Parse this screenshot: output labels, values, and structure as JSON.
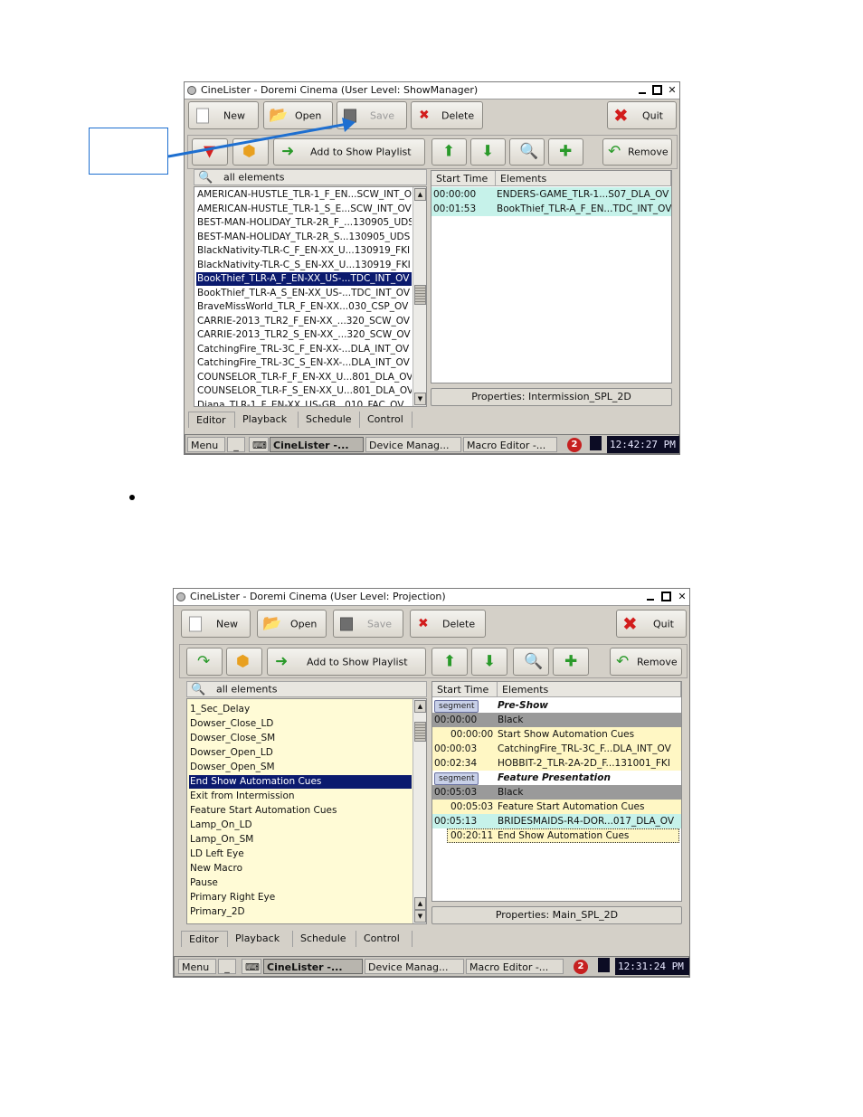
{
  "window1": {
    "title": "CineLister - Doremi Cinema (User Level: ShowManager)",
    "toolbar": {
      "new": "New",
      "open": "Open",
      "save": "Save",
      "delete": "Delete",
      "quit": "Quit",
      "add_to_playlist": "Add to Show Playlist",
      "remove": "Remove"
    },
    "search_label": "all elements",
    "list": [
      "AMERICAN-HUSTLE_TLR-1_F_EN...SCW_INT_OV",
      "AMERICAN-HUSTLE_TLR-1_S_E...SCW_INT_OV",
      "BEST-MAN-HOLIDAY_TLR-2R_F_...130905_UDS",
      "BEST-MAN-HOLIDAY_TLR-2R_S...130905_UDS",
      "BlackNativity-TLR-C_F_EN-XX_U...130919_FKI",
      "BlackNativity-TLR-C_S_EN-XX_U...130919_FKI",
      "BookThief_TLR-A_F_EN-XX_US-...TDC_INT_OV",
      "BookThief_TLR-A_S_EN-XX_US-...TDC_INT_OV",
      "BraveMissWorld_TLR_F_EN-XX...030_CSP_OV",
      "CARRIE-2013_TLR2_F_EN-XX_...320_SCW_OV",
      "CARRIE-2013_TLR2_S_EN-XX_...320_SCW_OV",
      "CatchingFire_TRL-3C_F_EN-XX-...DLA_INT_OV",
      "CatchingFire_TRL-3C_S_EN-XX-...DLA_INT_OV",
      "COUNSELOR_TLR-F_F_EN-XX_U...801_DLA_OV",
      "COUNSELOR_TLR-F_S_EN-XX_U...801_DLA_OV",
      "Diana_TLR-1_F_EN-XX_US-GB...010_FAC_OV"
    ],
    "selected_index": 6,
    "columns": {
      "start": "Start Time",
      "elements": "Elements"
    },
    "playlist": [
      {
        "time": "00:00:00",
        "name": "ENDERS-GAME_TLR-1...S07_DLA_OV"
      },
      {
        "time": "00:01:53",
        "name": "BookThief_TLR-A_F_EN...TDC_INT_OV"
      }
    ],
    "properties": "Properties: Intermission_SPL_2D",
    "tabs": [
      "Editor",
      "Playback",
      "Schedule",
      "Control"
    ],
    "taskbar": {
      "menu": "Menu",
      "minimize": "_",
      "tasks": [
        "CineLister -...",
        "Device Manag...",
        "Macro Editor -..."
      ],
      "badge": "2",
      "clock": "12:42:27 PM"
    }
  },
  "window2": {
    "title": "CineLister - Doremi Cinema (User Level: Projection)",
    "toolbar": {
      "new": "New",
      "open": "Open",
      "save": "Save",
      "delete": "Delete",
      "quit": "Quit",
      "add_to_playlist": "Add to Show Playlist",
      "remove": "Remove"
    },
    "search_label": "all elements",
    "list": [
      "1_Sec_Delay",
      "Dowser_Close_LD",
      "Dowser_Close_SM",
      "Dowser_Open_LD",
      "Dowser_Open_SM",
      "End Show Automation Cues",
      "Exit from Intermission",
      "Feature Start Automation Cues",
      "Lamp_On_LD",
      "Lamp_On_SM",
      "LD Left Eye",
      "New Macro",
      "Pause",
      "Primary Right Eye",
      "Primary_2D"
    ],
    "selected_index": 5,
    "columns": {
      "start": "Start Time",
      "elements": "Elements"
    },
    "playlist": [
      {
        "kind": "segment",
        "tag": "segment",
        "name": "Pre-Show"
      },
      {
        "kind": "black",
        "time": "00:00:00",
        "name": "Black"
      },
      {
        "kind": "cue",
        "time": "00:00:00",
        "name": "Start Show Automation Cues"
      },
      {
        "kind": "clip",
        "time": "00:00:03",
        "name": "CatchingFire_TRL-3C_F...DLA_INT_OV"
      },
      {
        "kind": "clip",
        "time": "00:02:34",
        "name": "HOBBIT-2_TLR-2A-2D_F...131001_FKI"
      },
      {
        "kind": "segment",
        "tag": "segment",
        "name": "Feature Presentation"
      },
      {
        "kind": "black",
        "time": "00:05:03",
        "name": "Black"
      },
      {
        "kind": "cue",
        "time": "00:05:03",
        "name": "Feature Start Automation Cues"
      },
      {
        "kind": "feature",
        "time": "00:05:13",
        "name": "BRIDESMAIDS-R4-DOR...017_DLA_OV"
      },
      {
        "kind": "cue-sel",
        "time": "00:20:11",
        "name": "End Show Automation Cues"
      }
    ],
    "properties": "Properties: Main_SPL_2D",
    "tabs": [
      "Editor",
      "Playback",
      "Schedule",
      "Control"
    ],
    "taskbar": {
      "menu": "Menu",
      "minimize": "_",
      "tasks": [
        "CineLister -...",
        "Device Manag...",
        "Macro Editor -..."
      ],
      "badge": "2",
      "clock": "12:31:24 PM"
    }
  },
  "colors": {
    "selection": "#0b1a6e",
    "list_cream": "#fffbd6",
    "cue_yellow": "#fff7c4",
    "feature_teal": "#c6f2ea",
    "black_row": "#9a9a9a",
    "arrow_blue": "#1e6fd0"
  }
}
